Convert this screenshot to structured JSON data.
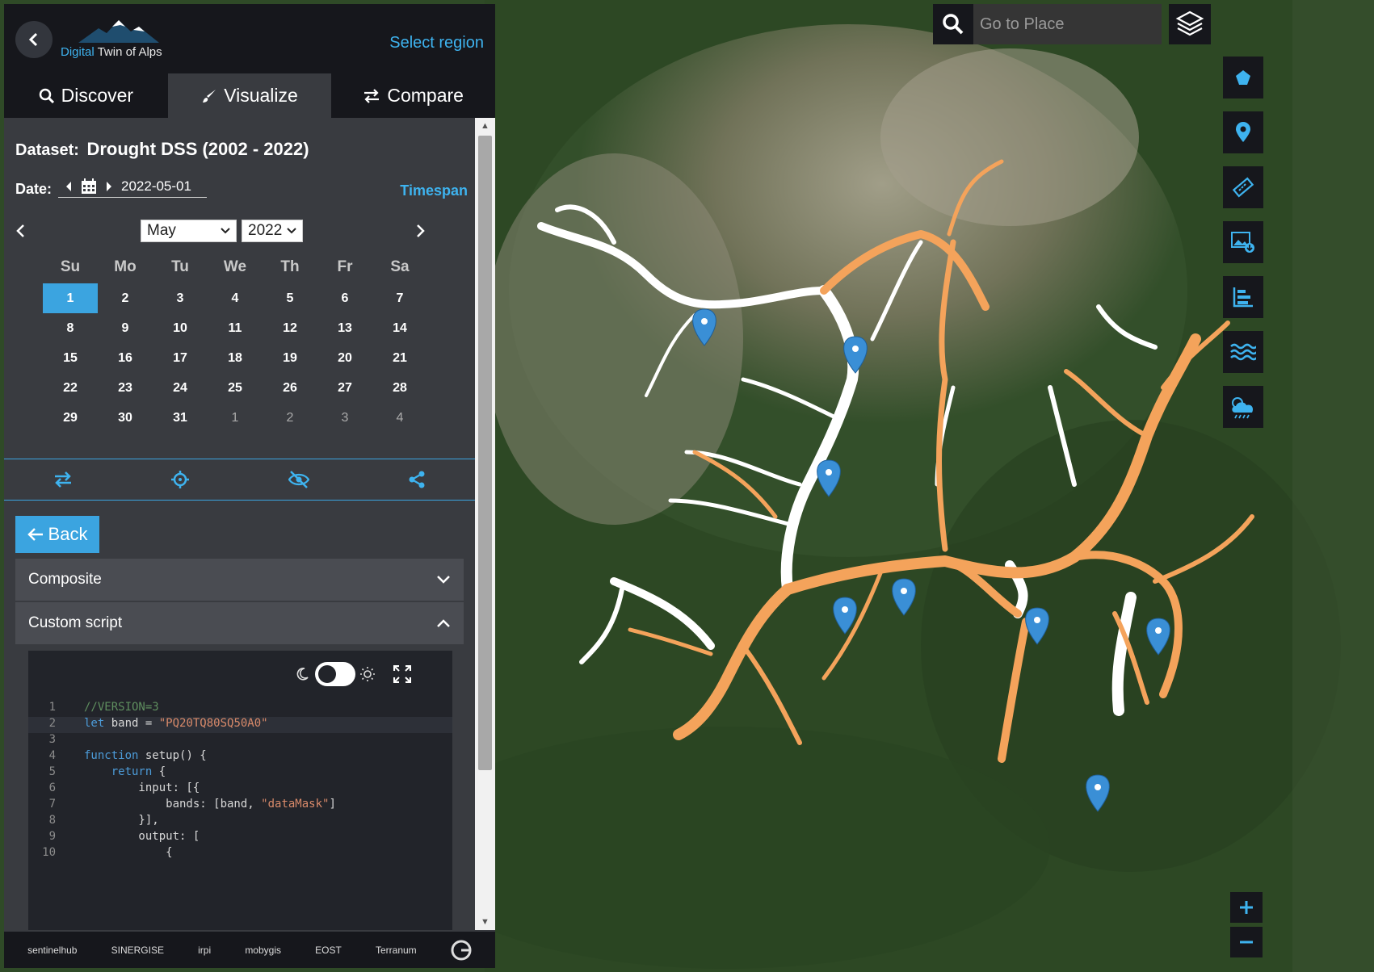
{
  "app": {
    "logo_accent": "Digital",
    "logo_rest": " Twin of Alps",
    "select_region": "Select region"
  },
  "tabs": [
    {
      "label": "Discover",
      "icon": "search-icon"
    },
    {
      "label": "Visualize",
      "icon": "brush-icon"
    },
    {
      "label": "Compare",
      "icon": "swap-icon"
    }
  ],
  "dataset": {
    "label": "Dataset:",
    "value": "Drought DSS (2002 - 2022)"
  },
  "date": {
    "label": "Date:",
    "value": "2022-05-01",
    "timespan": "Timespan"
  },
  "calendar": {
    "month": "May",
    "year": "2022",
    "weekdays": [
      "Su",
      "Mo",
      "Tu",
      "We",
      "Th",
      "Fr",
      "Sa"
    ],
    "selected_day": "1",
    "weeks": [
      [
        "1",
        "2",
        "3",
        "4",
        "5",
        "6",
        "7"
      ],
      [
        "8",
        "9",
        "10",
        "11",
        "12",
        "13",
        "14"
      ],
      [
        "15",
        "16",
        "17",
        "18",
        "19",
        "20",
        "21"
      ],
      [
        "22",
        "23",
        "24",
        "25",
        "26",
        "27",
        "28"
      ],
      [
        "29",
        "30",
        "31",
        "1",
        "2",
        "3",
        "4"
      ]
    ]
  },
  "buttons": {
    "back": "Back"
  },
  "accordion": {
    "composite": "Composite",
    "custom_script": "Custom script"
  },
  "code_lines": [
    {
      "n": "1",
      "text": "//VERSION=3"
    },
    {
      "n": "2",
      "text": "let band = \"PQ20TQ80SQ50A0\""
    },
    {
      "n": "3",
      "text": ""
    },
    {
      "n": "4",
      "text": "function setup() {"
    },
    {
      "n": "5",
      "text": "    return {"
    },
    {
      "n": "6",
      "text": "        input: [{"
    },
    {
      "n": "7",
      "text": "            bands: [band, \"dataMask\"]"
    },
    {
      "n": "8",
      "text": "        }],"
    },
    {
      "n": "9",
      "text": "        output: ["
    },
    {
      "n": "10",
      "text": "            {"
    }
  ],
  "search": {
    "placeholder": "Go to Place"
  },
  "footer": {
    "logos": [
      "sentinelhub",
      "SINERGISE",
      "irpi",
      "mobygis",
      "EOST",
      "Terranum"
    ]
  },
  "colors": {
    "accent": "#3eb3ef",
    "selected": "#3ba4e0",
    "river_dry": "#f4a35b",
    "river_normal": "#ffffff",
    "pin": "#3a8fd6"
  }
}
